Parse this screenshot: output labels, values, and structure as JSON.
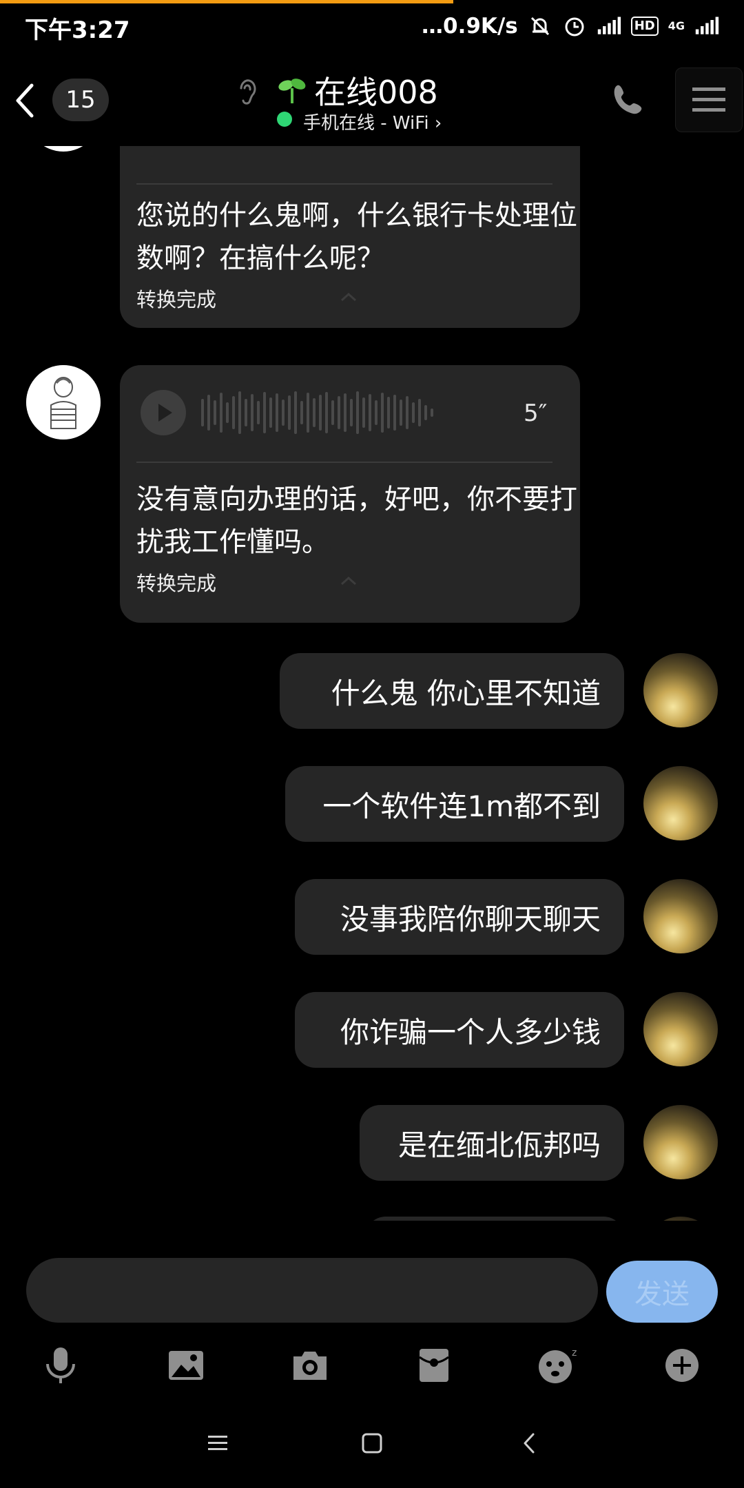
{
  "status_bar": {
    "time": "下午3:27",
    "speed": "…0.9K/s",
    "hd": "HD",
    "network": "4G"
  },
  "header": {
    "unread_count": "15",
    "contact_name": "在线008",
    "online_status": "手机在线 - WiFi ›"
  },
  "messages": {
    "voice1": {
      "transcript": "您说的什么鬼啊，什么银行卡处理位数啊？在搞什么呢？",
      "status": "转换完成"
    },
    "voice2": {
      "duration": "5″",
      "transcript": "没有意向办理的话，好吧，你不要打扰我工作懂吗。",
      "status": "转换完成"
    },
    "sent": [
      "什么鬼  你心里不知道",
      "一个软件连1m都不到",
      "没事我陪你聊天聊天",
      "你诈骗一个人多少钱",
      "是在缅北佤邦吗"
    ]
  },
  "input": {
    "value": "",
    "send_label": "发送"
  },
  "colors": {
    "accent_progress": "#f39c12",
    "online": "#2fd675",
    "send_button": "#87b6ee",
    "bubble": "#262626"
  },
  "toolbar_icons": [
    "mic-icon",
    "image-icon",
    "camera-icon",
    "red-packet-icon",
    "emoji-icon",
    "plus-icon"
  ],
  "nav_icons": [
    "menu-icon",
    "home-icon",
    "back-icon"
  ]
}
